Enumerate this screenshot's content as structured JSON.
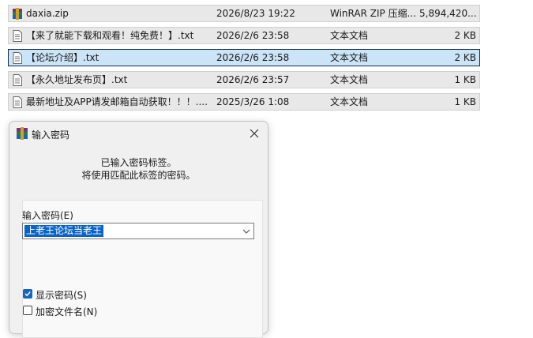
{
  "files": [
    {
      "name": "daxia.zip",
      "date": "2026/8/23 19:22",
      "type": "WinRAR ZIP 压缩...",
      "size": "5,894,420...",
      "icon": "winrar-zip-icon",
      "selected": false
    },
    {
      "name": "【来了就能下载和观看！纯免费！】.txt",
      "date": "2026/2/6 23:58",
      "type": "文本文档",
      "size": "2 KB",
      "icon": "text-file-icon",
      "selected": false
    },
    {
      "name": "【论坛介绍】.txt",
      "date": "2026/2/6 23:58",
      "type": "文本文档",
      "size": "2 KB",
      "icon": "text-file-icon",
      "selected": true
    },
    {
      "name": "【永久地址发布页】.txt",
      "date": "2026/2/6 23:57",
      "type": "文本文档",
      "size": "1 KB",
      "icon": "text-file-icon",
      "selected": false
    },
    {
      "name": "最新地址及APP请发邮箱自动获取！！！....",
      "date": "2025/3/26 1:08",
      "type": "文本文档",
      "size": "1 KB",
      "icon": "text-file-icon",
      "selected": false
    }
  ],
  "dialog": {
    "title": "输入密码",
    "icon": "winrar-icon",
    "close_icon": "close-icon",
    "info_line1": "已输入密码标签。",
    "info_line2": "将使用匹配此标签的密码。",
    "password_label": "输入密码(E)",
    "password_value": "上老王论坛当老王",
    "show_password_label": "显示密码(S)",
    "show_password_checked": true,
    "encrypt_filenames_label": "加密文件名(N)",
    "encrypt_filenames_checked": false
  },
  "colors": {
    "selection_bg": "#cce4f7",
    "selection_border": "#0b2a4a",
    "row_bg": "#e8e8e8",
    "highlight_text_bg": "#0a64c8",
    "checkbox_accent": "#1565c0"
  }
}
